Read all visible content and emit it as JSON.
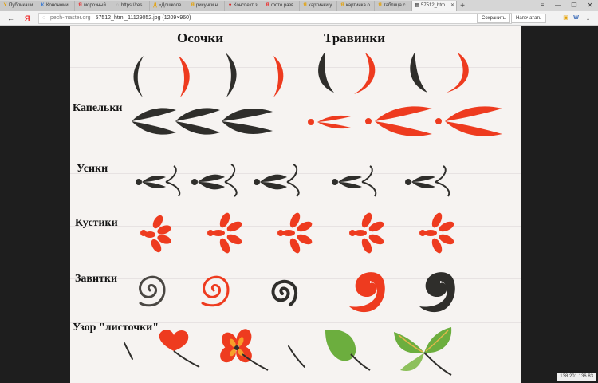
{
  "browser": {
    "tabs": [
      {
        "label": "Публикаци",
        "icon": "У"
      },
      {
        "label": "Конономи",
        "icon": "К"
      },
      {
        "label": "морозный",
        "icon": "Я"
      },
      {
        "label": "https://res",
        "icon": "◌"
      },
      {
        "label": "«Дошколе",
        "icon": "Д"
      },
      {
        "label": "рисунки н",
        "icon": "Я"
      },
      {
        "label": "Конспект з",
        "icon": "♥"
      },
      {
        "label": "фото разв",
        "icon": "Я"
      },
      {
        "label": "картинки у",
        "icon": "Я"
      },
      {
        "label": "картинка о",
        "icon": "Я"
      },
      {
        "label": "таблица с",
        "icon": "Я"
      },
      {
        "label": "57512_htm",
        "icon": "▤",
        "active": true
      }
    ],
    "new_tab": "+",
    "window": {
      "menu": "≡",
      "minimize": "—",
      "restore": "❐",
      "close": "✕"
    },
    "back": "←",
    "yandex": "Я",
    "address": {
      "site": "pech-master.org",
      "title": "57512_html_11129052.jpg (1209×960)"
    },
    "save_label": "Сохранить",
    "print_label": "Напечатать",
    "status_text": "138.201.136.83"
  },
  "sheet": {
    "headings": {
      "osochki": "Осочки",
      "travinki": "Травинки",
      "kapelki": "Капельки",
      "usiki": "Усики",
      "kustiki": "Кустики",
      "zavitki": "Завитки",
      "uzor": "Узор \"листочки\""
    },
    "colors": {
      "red": "#ee3b1f",
      "black": "#2f2e2b",
      "paper": "#f6f3f1",
      "green": "#6cae3e"
    }
  }
}
